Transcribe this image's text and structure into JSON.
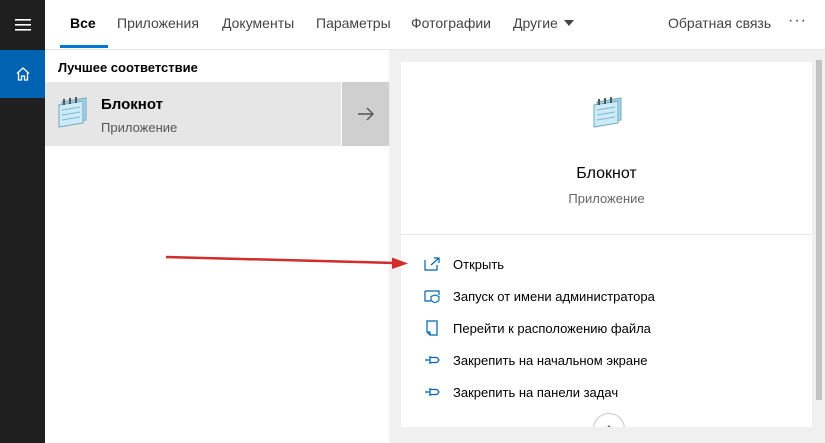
{
  "tabs": [
    {
      "label": "Все",
      "active": true
    },
    {
      "label": "Приложения"
    },
    {
      "label": "Документы"
    },
    {
      "label": "Параметры"
    },
    {
      "label": "Фотографии"
    },
    {
      "label": "Другие"
    }
  ],
  "feedback_label": "Обратная связь",
  "more_label": "···",
  "rail": {
    "menu_icon": "hamburger-icon",
    "home_icon": "home-icon",
    "accent": "#0063b1"
  },
  "results": {
    "section_title": "Лучшее соответствие",
    "best_match": {
      "name": "Блокнот",
      "type": "Приложение",
      "icon": "notepad-icon"
    }
  },
  "details": {
    "name": "Блокнот",
    "type": "Приложение",
    "actions": [
      {
        "label": "Открыть",
        "icon": "open-icon"
      },
      {
        "label": "Запуск от имени администратора",
        "icon": "admin-shield-icon"
      },
      {
        "label": "Перейти к расположению файла",
        "icon": "file-location-icon"
      },
      {
        "label": "Закрепить на начальном экране",
        "icon": "pin-icon"
      },
      {
        "label": "Закрепить на панели задач",
        "icon": "pin-icon"
      }
    ]
  },
  "colors": {
    "accent": "#0078d7",
    "annotation_arrow": "#d42b2b"
  }
}
